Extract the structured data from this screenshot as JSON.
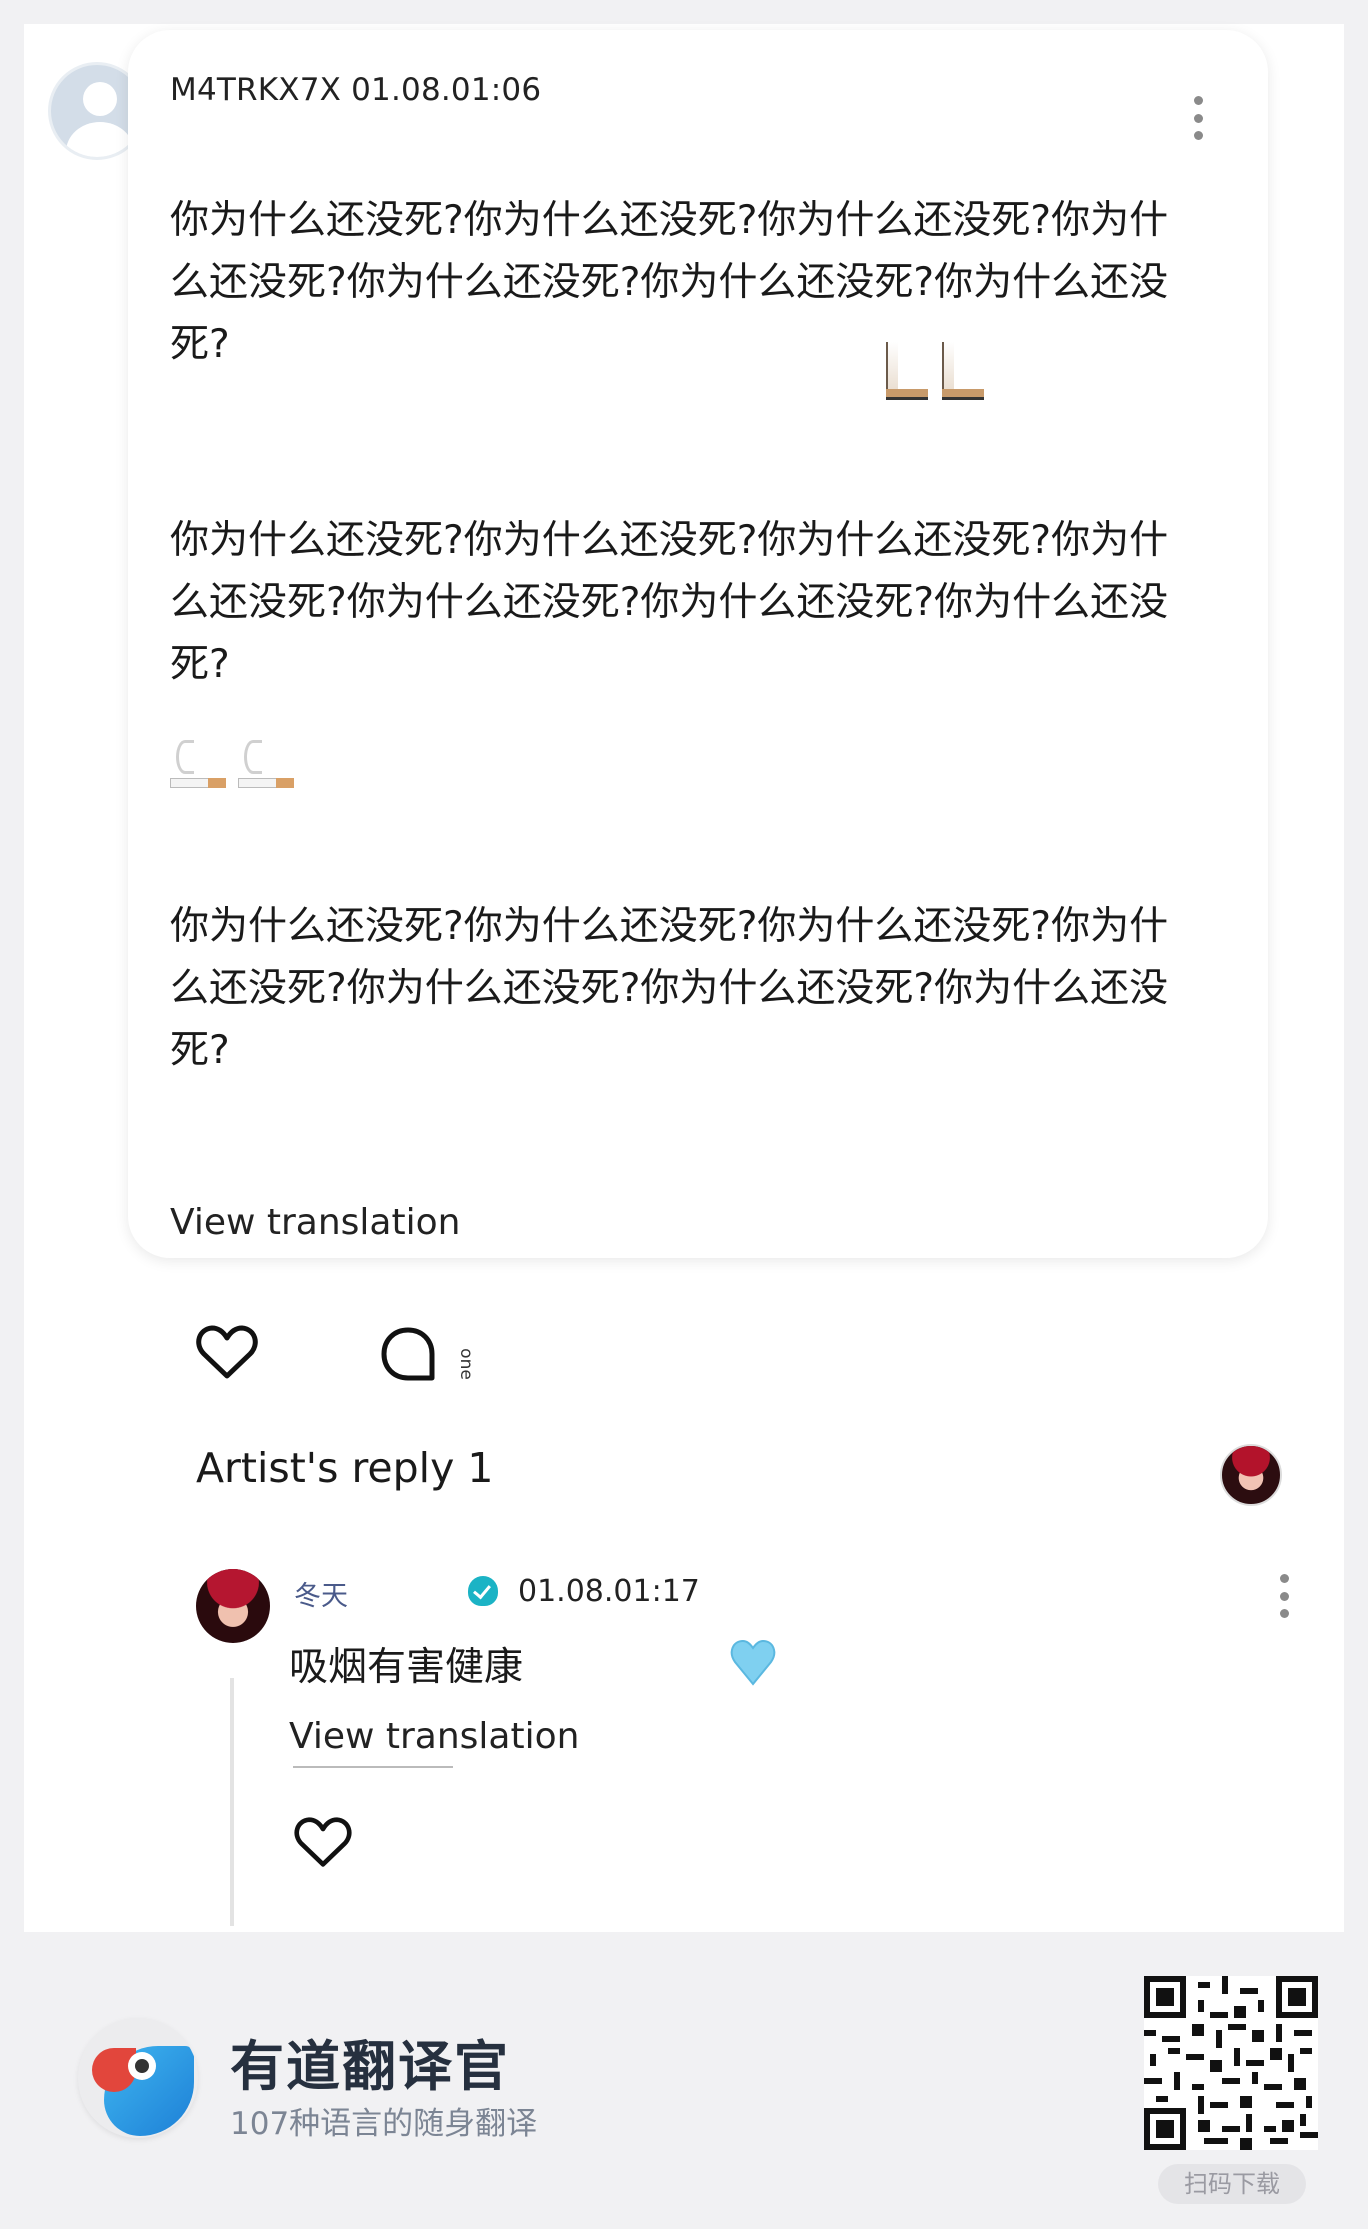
{
  "post": {
    "author_line": "M4TRKX7X 01.08.01:06",
    "paragraphs": [
      "你为什么还没死?你为什么还没死?你为什么还没死?你为什么还没死?你为什么还没死?你为什么还没死?你为什么还没死?",
      "你为什么还没死?你为什么还没死?你为什么还没死?你为什么还没死?你为什么还没死?你为什么还没死?你为什么还没死?",
      "你为什么还没死?你为什么还没死?你为什么还没死?你为什么还没死?你为什么还没死?你为什么还没死?你为什么还没死?"
    ],
    "view_translation": "View translation",
    "comment_count": "one"
  },
  "replies": {
    "title": "Artist's reply 1",
    "items": [
      {
        "name": "冬天",
        "time": "01.08.01:17",
        "text": "吸烟有害健康",
        "view_translation": "View translation"
      }
    ]
  },
  "footer": {
    "brand": "有道翻译官",
    "tagline": "107种语言的随身翻译",
    "qr_label": "扫码下载"
  },
  "colors": {
    "verified_badge": "#1bb3c5",
    "blue_heart": "#7fd0f0",
    "brand_text": "#26303f"
  }
}
